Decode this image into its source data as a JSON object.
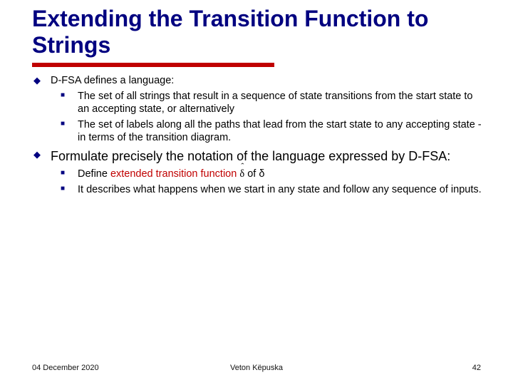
{
  "title": "Extending the Transition Function to Strings",
  "b1": {
    "text": "D-FSA defines a language:",
    "s1": "The set of all strings that result in a sequence of state transitions from the start state to an accepting state, or alternatively",
    "s2": "The set of labels along all the paths that lead from the start state to any accepting state - in terms of the transition diagram."
  },
  "b2": {
    "text": "Formulate precisely the notation of the language expressed by D-FSA:",
    "s1a": "Define ",
    "s1b": "extended transition function",
    "s1c": " of δ",
    "s2": "It describes what happens when we start in any state and follow any sequence of inputs."
  },
  "footer": {
    "date": "04 December 2020",
    "author": "Veton Këpuska",
    "page": "42"
  }
}
